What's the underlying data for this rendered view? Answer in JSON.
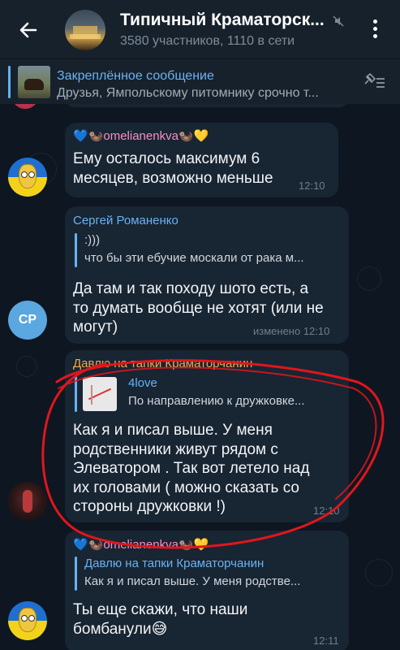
{
  "header": {
    "title": "Типичный Краматорск...",
    "subtitle": "3580 участников, 1110 в сети"
  },
  "pinned": {
    "title": "Закреплённое сообщение",
    "text": "Друзья, Ямпольскому питомнику срочно т..."
  },
  "messages": [
    {
      "sender": "💙🦦omelianenkva🦦💛",
      "lines": [
        "Ему осталось максимум 6",
        "месяцев, возможно меньше"
      ],
      "time": "12:10"
    },
    {
      "sender": "Сергей Романенко",
      "reply_name": ":)))",
      "reply_text": "что бы эти ебучие москали от рака м...",
      "lines": [
        "Да там и так походу шото есть, а",
        "то думать вообще не хотят (или не",
        "могут)"
      ],
      "time": "изменено 12:10",
      "avatar_initials": "СР"
    },
    {
      "sender": "Давлю на тапки Краматорчанин",
      "reply_name": "4love",
      "reply_text": "По направлению к дружковке...",
      "lines": [
        "Как я и писал выше. У меня",
        "родственники живут рядом с",
        "Элеватором . Так вот летело над",
        "их головами ( можно сказать со",
        "стороны дружковки !)"
      ],
      "time": "12:10"
    },
    {
      "sender": "💙🦦omelianenkva🦦💛",
      "reply_name": "Давлю на тапки Краматорчанин",
      "reply_text": "Как я и писал выше. У меня родстве...",
      "lines": [
        "Ты еще скажи, что наши",
        "бомбанули😅"
      ],
      "time": "12:11"
    }
  ],
  "colors": {
    "accent": "#6ab2f2",
    "bubble": "#182533",
    "background": "#0e1621",
    "annotation": "#e0161c"
  },
  "icons": {
    "back": "arrow-left-icon",
    "menu": "more-vertical-icon",
    "mute": "mute-icon",
    "pin_list": "pinned-list-icon"
  }
}
